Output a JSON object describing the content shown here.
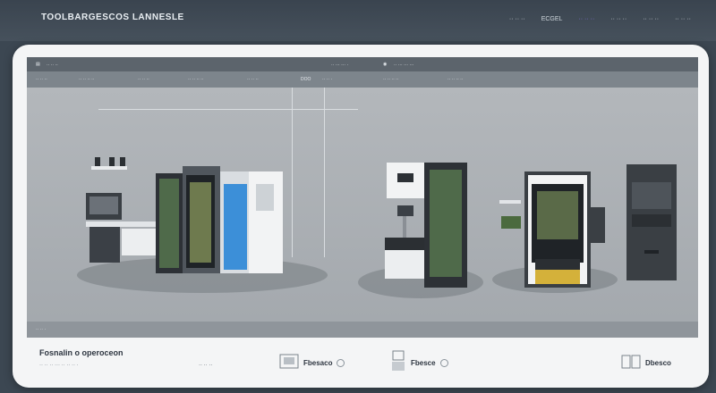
{
  "header": {
    "brand": "TOOLBARGESCOS LANNESLE",
    "nav": [
      "·· ·· ··",
      "ECGEL",
      "·· ·· ··",
      "·· ·· ··",
      "·· ·· ··",
      "·· ·· ··"
    ]
  },
  "toolbar": {
    "left_label": "·· ·· ··",
    "center_label": "·· ··· ··· ·",
    "right_label": "·· ··· ··· ···"
  },
  "subtoolbar": {
    "items": [
      "·· ·· ··",
      "·· ·· ·· ··",
      "·· ·· ··",
      "·· ·· ·· ··",
      "·· ·· ··",
      "DOO",
      "·· ·· ·",
      "·· ·· ·· ··",
      "·· ·· ·· ··"
    ]
  },
  "footer_bar": {
    "label": "·· ·· ·"
  },
  "bottom": {
    "title": "Fosnalin o operoceon",
    "subtitle": "·· ·· ·· ··· ·· ·· ·· ·",
    "more": "·· ·· ··",
    "features": [
      {
        "label": "Fbesaco",
        "icon": "cabinet-icon"
      },
      {
        "label": "Fbesce",
        "icon": "kiosk-icon"
      },
      {
        "label": "Dbesco",
        "icon": "server-rack-icon"
      }
    ]
  },
  "colors": {
    "accent": "#7c6fd6",
    "dark": "#3c4752",
    "panel": "#a9adb1"
  }
}
